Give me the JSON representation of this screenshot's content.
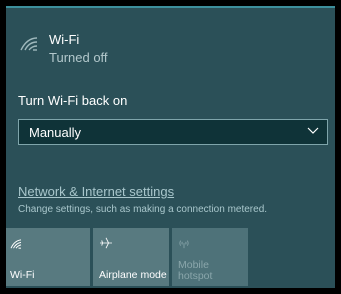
{
  "wifi": {
    "title": "Wi-Fi",
    "status": "Turned off",
    "icon": "wifi-off-icon"
  },
  "turn_on": {
    "label": "Turn Wi-Fi back on",
    "selected": "Manually"
  },
  "network_settings": {
    "link": "Network & Internet settings",
    "description": "Change settings, such as making a connection metered."
  },
  "tiles": {
    "wifi": {
      "label": "Wi-Fi",
      "icon": "wifi-icon"
    },
    "airplane": {
      "label": "Airplane mode",
      "icon": "airplane-icon"
    },
    "hotspot": {
      "label": "Mobile hotspot",
      "icon": "hotspot-icon"
    }
  },
  "colors": {
    "panel_bg": "#2b5058",
    "accent_top": "#3d8f9c",
    "tile_bg": "#587a80",
    "dropdown_bg": "#0f3338"
  }
}
